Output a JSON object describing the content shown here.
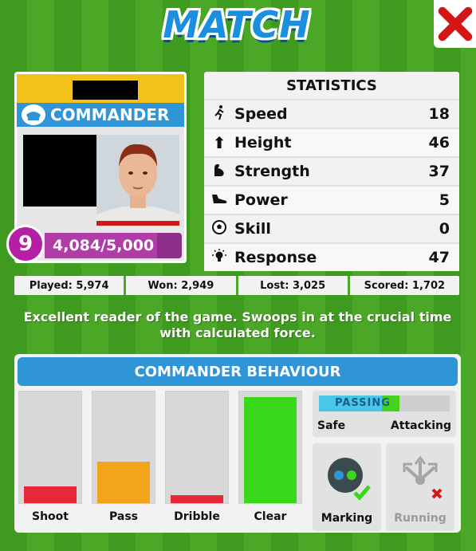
{
  "header": {
    "title": "MATCH"
  },
  "player": {
    "role": "COMMANDER",
    "level": "9",
    "xp_text": "4,084/5,000",
    "xp_fraction": 0.817
  },
  "statistics": {
    "title": "STATISTICS",
    "rows": [
      {
        "icon": "running-icon",
        "label": "Speed",
        "value": "18"
      },
      {
        "icon": "arrow-up-icon",
        "label": "Height",
        "value": "46"
      },
      {
        "icon": "flexed-arm-icon",
        "label": "Strength",
        "value": "37"
      },
      {
        "icon": "boot-icon",
        "label": "Power",
        "value": "5"
      },
      {
        "icon": "football-icon",
        "label": "Skill",
        "value": "0"
      },
      {
        "icon": "light-bulb-icon",
        "label": "Response",
        "value": "47"
      }
    ]
  },
  "summary": {
    "played": "Played: 5,974",
    "won": "Won: 2,949",
    "lost": "Lost: 3,025",
    "scored": "Scored: 1,702"
  },
  "description": "Excellent reader of the game. Swoops in at the crucial time with calculated force.",
  "behaviour": {
    "title": "COMMANDER BEHAVIOUR",
    "bars": [
      {
        "label": "Shoot",
        "level": 0.15,
        "color": "#e82838"
      },
      {
        "label": "Pass",
        "level": 0.37,
        "color": "#f2a41a"
      },
      {
        "label": "Dribble",
        "level": 0.07,
        "color": "#e82838"
      },
      {
        "label": "Clear",
        "level": 0.95,
        "color": "#39d81a"
      }
    ],
    "passing": {
      "label": "PASSING",
      "left": "Safe",
      "right": "Attacking",
      "level": 0.52
    },
    "toggles": [
      {
        "label": "Marking",
        "icon": "marking-icon",
        "enabled": true
      },
      {
        "label": "Running",
        "icon": "running-arrows-icon",
        "enabled": false
      }
    ]
  },
  "colors": {
    "accent": "#2f95d6",
    "level_badge": "#b51fa6",
    "pitch": "#4aa826"
  }
}
